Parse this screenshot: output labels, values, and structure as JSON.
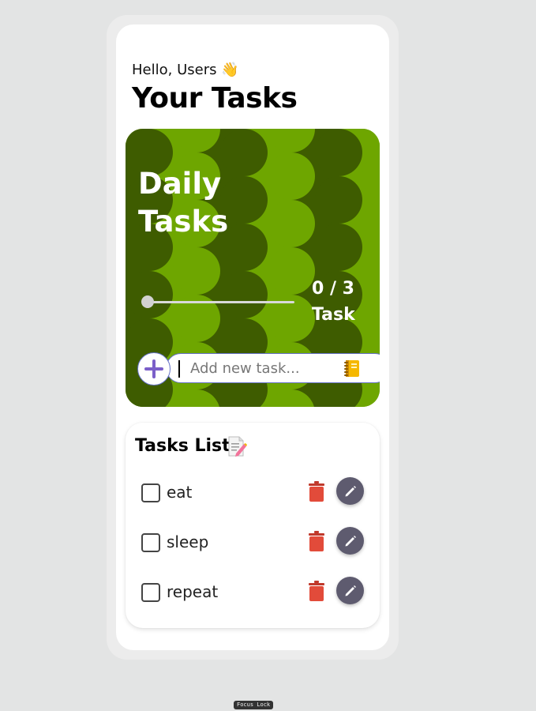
{
  "greeting": "Hello, Users 👋",
  "page_title": "Your Tasks",
  "summary_card": {
    "title_line1": "Daily",
    "title_line2": "Tasks",
    "completed": 0,
    "total": 3,
    "progress_text": "0 / 3",
    "unit_label": "Task",
    "progress_fraction": 0
  },
  "add_task": {
    "placeholder": "Add new task...",
    "value": "",
    "add_icon": "plus-icon",
    "notebook_icon": "notebook-icon"
  },
  "task_list": {
    "title": "Tasks List",
    "title_icon": "memo-icon",
    "items": [
      {
        "label": "eat",
        "checked": false
      },
      {
        "label": "sleep",
        "checked": false
      },
      {
        "label": "repeat",
        "checked": false
      }
    ],
    "delete_icon": "trash-icon",
    "edit_icon": "pencil-icon"
  },
  "footer_badge": "Focus Lock",
  "colors": {
    "page_bg": "#e3e4e4",
    "card_light_green": "#6ea600",
    "card_dark_green": "#3e5c00",
    "accent_purple": "#6571c8",
    "delete_red": "#e24b3a",
    "edit_button": "#5e5b6f"
  }
}
